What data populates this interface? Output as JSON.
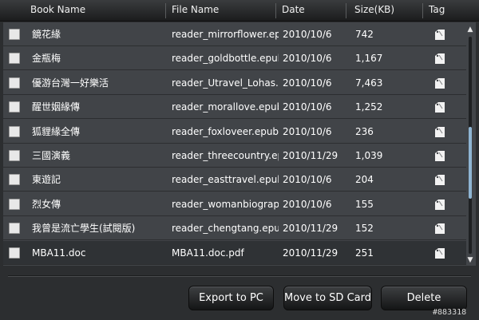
{
  "header": {
    "book_name": "Book Name",
    "file_name": "File Name",
    "date": "Date",
    "size": "Size(KB)",
    "tag": "Tag"
  },
  "rows": [
    {
      "book": "鏡花緣",
      "file": "reader_mirrorflower.epub",
      "date": "2010/10/6",
      "size": "742"
    },
    {
      "book": "金瓶梅",
      "file": "reader_goldbottle.epub",
      "date": "2010/10/6",
      "size": "1,167"
    },
    {
      "book": "優游台灣一好樂活",
      "file": "reader_Utravel_Lohas.epub",
      "date": "2010/10/6",
      "size": "7,463"
    },
    {
      "book": "醒世姻緣傳",
      "file": "reader_morallove.epub",
      "date": "2010/10/6",
      "size": "1,252"
    },
    {
      "book": "狐貍緣全傳",
      "file": "reader_foxloveer.epub",
      "date": "2010/10/6",
      "size": "236"
    },
    {
      "book": "三國演義",
      "file": "reader_threecountry.epub",
      "date": "2010/11/29",
      "size": "1,039"
    },
    {
      "book": "東遊記",
      "file": "reader_easttravel.epub",
      "date": "2010/10/6",
      "size": "204"
    },
    {
      "book": "烈女傳",
      "file": "reader_womanbiography.epub",
      "date": "2010/10/6",
      "size": "155"
    },
    {
      "book": "我曾是流亡學生(試閱版)",
      "file": "reader_chengtang.epub",
      "date": "2010/11/29",
      "size": "152"
    },
    {
      "book": "MBA11.doc",
      "file": "MBA11.doc.pdf",
      "date": "2010/11/29",
      "size": "251"
    }
  ],
  "selected_row": 9,
  "scroll_position": 0.62,
  "buttons": {
    "export": "Export to PC",
    "move": "Move to SD Card",
    "delete": "Delete"
  },
  "watermark": "#883318",
  "colors": {
    "accent_scroll": "#8fb5d3",
    "row_bg": "#414448",
    "selected_bg": "#2f3235"
  }
}
